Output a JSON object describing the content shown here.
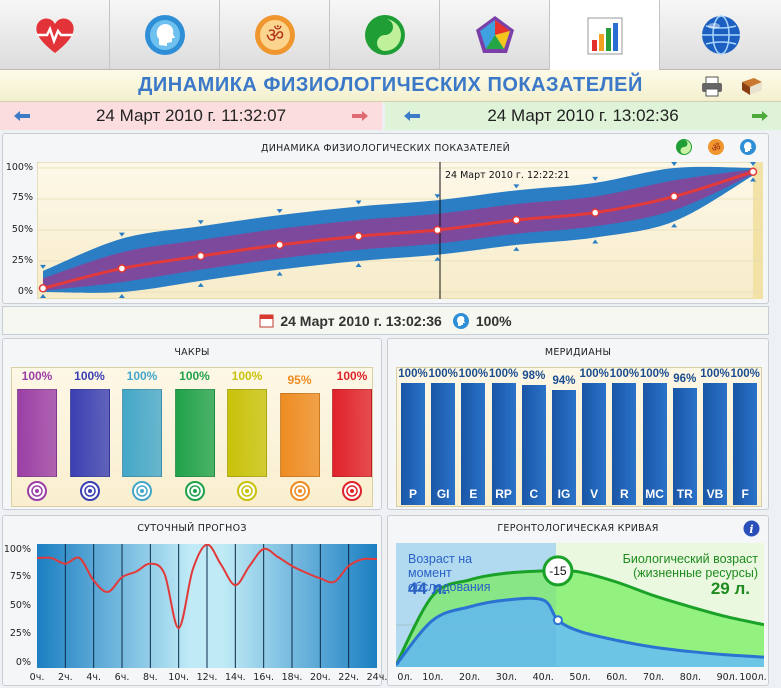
{
  "tabs": [
    {
      "icon": "heart-icon"
    },
    {
      "icon": "head-profile-icon"
    },
    {
      "icon": "om-symbol-icon"
    },
    {
      "icon": "yin-yang-icon"
    },
    {
      "icon": "pentagon-chart-icon"
    },
    {
      "icon": "bar-chart-icon"
    },
    {
      "icon": "globe-icon"
    }
  ],
  "header": {
    "title": "ДИНАМИКА ФИЗИОЛОГИЧЕСКИХ ПОКАЗАТЕЛЕЙ",
    "icons": [
      "printer-icon",
      "book-icon"
    ]
  },
  "datebar": {
    "left_date": "24 Март 2010 г. 11:32:07",
    "right_date": "24 Март 2010 г. 13:02:36"
  },
  "dynamics": {
    "title": "ДИНАМИКА ФИЗИОЛОГИЧЕСКИХ ПОКАЗАТЕЛЕЙ",
    "cursor_label": "24 Март 2010 г. 12:22:21",
    "icons": [
      "yin-yang-icon",
      "om-symbol-icon",
      "head-profile-icon"
    ],
    "chart_data": {
      "type": "area",
      "y_ticks": [
        "100%",
        "75%",
        "50%",
        "25%",
        "0%"
      ],
      "ylim": [
        0,
        100
      ],
      "x": [
        0,
        1,
        2,
        3,
        4,
        5,
        6,
        7,
        8,
        9
      ],
      "series": [
        {
          "values": [
            3,
            19,
            29,
            38,
            45,
            50,
            58,
            64,
            77,
            97
          ]
        }
      ],
      "colors": {
        "line": "#e23a3a",
        "outer_band": "#2b7ec4",
        "inner_band": "#8c3f96"
      }
    }
  },
  "status": {
    "date": "24 Март 2010 г. 13:02:36",
    "value": "100%"
  },
  "chakras": {
    "title": "ЧАКРЫ",
    "chart_data": {
      "type": "bar",
      "values": [
        100,
        100,
        100,
        100,
        100,
        95,
        100
      ],
      "labels": [
        "100%",
        "100%",
        "100%",
        "100%",
        "100%",
        "95%",
        "100%"
      ],
      "colors": [
        "#9b3fa6",
        "#3a3fb2",
        "#44a7c9",
        "#20a24a",
        "#c8c20a",
        "#ee8c23",
        "#e0222b"
      ]
    }
  },
  "meridians": {
    "title": "МЕРИДИАНЫ",
    "chart_data": {
      "type": "bar",
      "categories": [
        "P",
        "GI",
        "E",
        "RP",
        "C",
        "IG",
        "V",
        "R",
        "MC",
        "TR",
        "VB",
        "F"
      ],
      "values": [
        100,
        100,
        100,
        100,
        98,
        94,
        100,
        100,
        100,
        96,
        100,
        100
      ],
      "labels": [
        "100%",
        "100%",
        "100%",
        "100%",
        "98%",
        "94%",
        "100%",
        "100%",
        "100%",
        "96%",
        "100%",
        "100%"
      ],
      "color": "#1e5fb0"
    }
  },
  "forecast": {
    "title": "СУТОЧНЫЙ ПРОГНОЗ",
    "chart_data": {
      "type": "line",
      "y_ticks": [
        "100%",
        "75%",
        "50%",
        "25%",
        "0%"
      ],
      "x_ticks": [
        "0ч.",
        "2ч.",
        "4ч.",
        "6ч.",
        "8ч.",
        "10ч.",
        "12ч.",
        "14ч.",
        "16ч.",
        "18ч.",
        "20ч.",
        "22ч.",
        "24ч."
      ],
      "x": [
        0,
        1,
        2,
        3,
        4,
        5,
        6,
        7,
        8,
        9,
        10,
        11,
        12,
        13,
        14,
        15,
        16,
        17,
        18,
        19,
        20,
        21,
        22,
        23,
        24
      ],
      "values": [
        92,
        92,
        87,
        92,
        72,
        62,
        75,
        80,
        87,
        78,
        30,
        82,
        104,
        86,
        68,
        85,
        100,
        93,
        85,
        79,
        74,
        71,
        85,
        91,
        91
      ],
      "ylim": [
        0,
        100
      ],
      "color": "#e23a3a"
    }
  },
  "gerontology": {
    "title": "ГЕРОНТОЛОГИЧЕСКАЯ КРИВАЯ",
    "left_caption": "Возраст на момент обследования",
    "left_age": "44 л.",
    "right_caption": "Биологический возраст (жизненные ресурсы)",
    "right_age": "29 л.",
    "diff": "-15",
    "info_icon": "info-icon",
    "chart_data": {
      "type": "area",
      "x_ticks": [
        "0л.",
        "10л.",
        "20л.",
        "30л.",
        "40л.",
        "50л.",
        "60л.",
        "70л.",
        "80л.",
        "90л.",
        "100л."
      ],
      "x": [
        0,
        10,
        20,
        30,
        40,
        44,
        50,
        60,
        70,
        80,
        90,
        100
      ],
      "series": [
        {
          "values": [
            0,
            62,
            76,
            82,
            84,
            84,
            83,
            74,
            62,
            52,
            43,
            36
          ]
        },
        {
          "values": [
            0,
            40,
            52,
            58,
            58,
            40,
            30,
            22,
            16,
            12,
            9,
            7
          ]
        }
      ],
      "colors": {
        "green": "#1aa228",
        "blue": "#2a73d2"
      }
    }
  }
}
